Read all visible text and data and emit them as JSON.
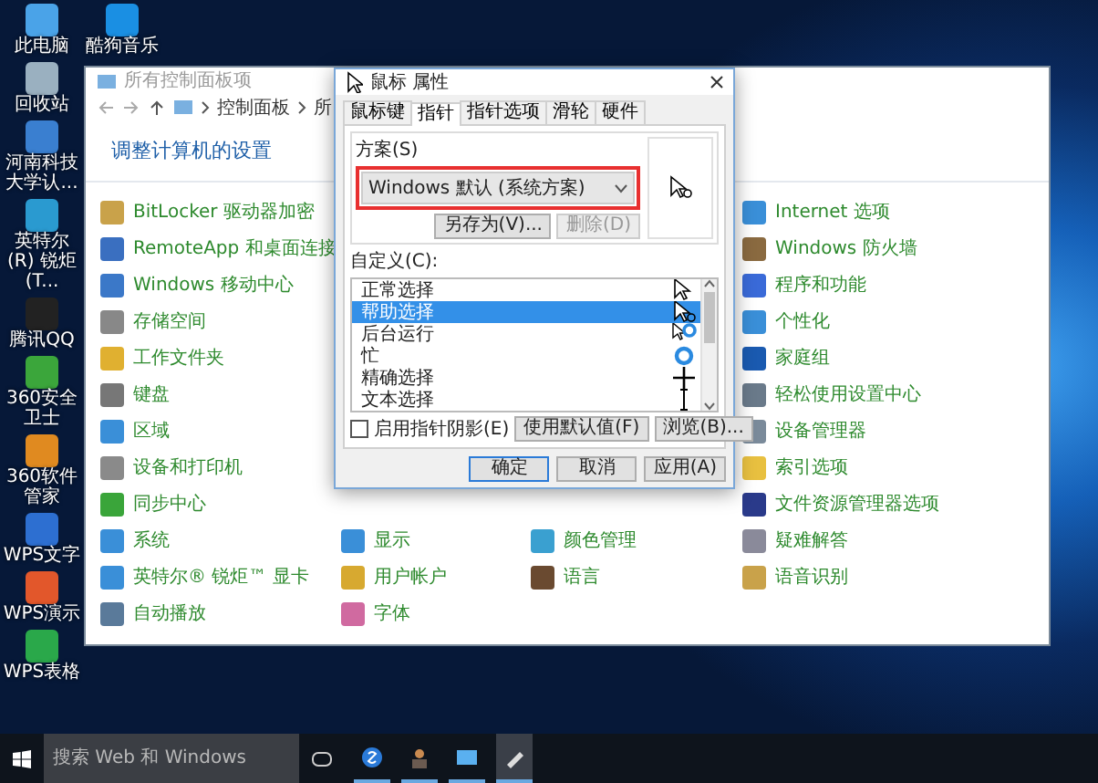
{
  "desktop_icons": [
    {
      "label": "此电脑"
    },
    {
      "label": "回收站"
    },
    {
      "label": "河南科技大学认..."
    },
    {
      "label": "英特尔(R) 锐炬(T..."
    },
    {
      "label": "腾讯QQ"
    },
    {
      "label": "360安全卫士"
    },
    {
      "label": "360软件管家"
    },
    {
      "label": "WPS文字"
    },
    {
      "label": "WPS演示"
    },
    {
      "label": "WPS表格"
    }
  ],
  "desktop_icons_column_2": [
    {
      "label": "酷狗音乐"
    }
  ],
  "control_panel": {
    "title": "所有控制面板项",
    "breadcrumb": [
      "控制面板",
      "所"
    ],
    "heading": "调整计算机的设置",
    "columns": [
      [
        {
          "label": "BitLocker 驱动器加密"
        },
        {
          "label": "RemoteApp 和桌面连接"
        },
        {
          "label": "Windows 移动中心"
        },
        {
          "label": "存储空间"
        },
        {
          "label": "工作文件夹"
        },
        {
          "label": "键盘"
        },
        {
          "label": "区域"
        },
        {
          "label": "设备和打印机"
        },
        {
          "label": "同步中心"
        },
        {
          "label": "系统"
        },
        {
          "label": "英特尔® 锐炬™ 显卡"
        },
        {
          "label": "自动播放"
        }
      ],
      [
        {
          "label": "显示"
        },
        {
          "label": "用户帐户"
        },
        {
          "label": "字体"
        }
      ],
      [
        {
          "label": "颜色管理"
        },
        {
          "label": "语言"
        }
      ],
      [
        {
          "label": "Internet 选项"
        },
        {
          "label": "Windows 防火墙"
        },
        {
          "label": "程序和功能"
        },
        {
          "label": "个性化"
        },
        {
          "label": "家庭组"
        },
        {
          "label": "轻松使用设置中心"
        },
        {
          "label": "设备管理器"
        },
        {
          "label": "索引选项"
        },
        {
          "label": "文件资源管理器选项"
        },
        {
          "label": "疑难解答"
        },
        {
          "label": "语音识别"
        }
      ]
    ]
  },
  "mouse_dialog": {
    "title": "鼠标 属性",
    "tabs": [
      {
        "label": "鼠标键",
        "selected": false
      },
      {
        "label": "指针",
        "selected": true
      },
      {
        "label": "指针选项",
        "selected": false
      },
      {
        "label": "滑轮",
        "selected": false
      },
      {
        "label": "硬件",
        "selected": false
      }
    ],
    "scheme_label": "方案(S)",
    "scheme": "Windows 默认 (系统方案)",
    "scheme_buttons": [
      {
        "label": "另存为(V)...",
        "disabled": false
      },
      {
        "label": "删除(D)",
        "disabled": true
      }
    ],
    "customize_label": "自定义(C):",
    "cursors": [
      {
        "label": "正常选择",
        "selected": false
      },
      {
        "label": "帮助选择",
        "selected": true
      },
      {
        "label": "后台运行",
        "selected": false
      },
      {
        "label": "忙",
        "selected": false
      },
      {
        "label": "精确选择",
        "selected": false
      },
      {
        "label": "文本选择",
        "selected": false
      }
    ],
    "shadow_checkbox": {
      "label": "启用指针阴影(E)",
      "checked": false
    },
    "list_buttons": [
      "使用默认值(F)",
      "浏览(B)..."
    ],
    "footer_buttons": [
      {
        "label": "确定",
        "default": true
      },
      {
        "label": "取消",
        "default": false
      },
      {
        "label": "应用(A)",
        "default": false
      }
    ]
  },
  "taskbar": {
    "search_placeholder": "搜索 Web 和 Windows"
  }
}
